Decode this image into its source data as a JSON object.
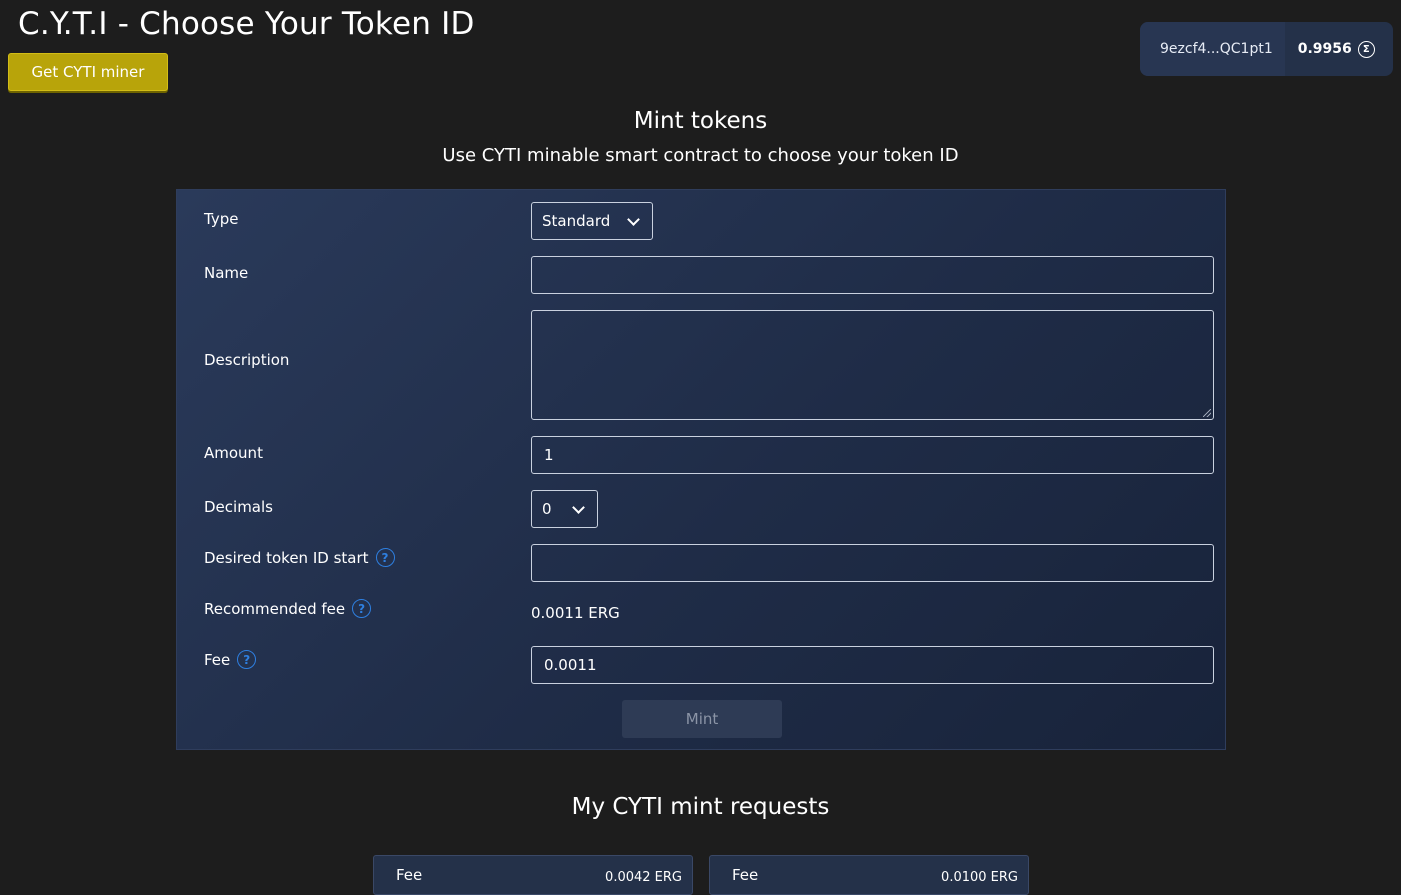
{
  "header": {
    "title": "C.Y.T.I - Choose Your Token ID",
    "get_miner_label": "Get CYTI miner"
  },
  "wallet": {
    "address": "9ezcf4...QC1pt1",
    "balance": "0.9956",
    "currency_icon": "erg-sigma-icon"
  },
  "mint_section": {
    "title": "Mint tokens",
    "subtitle": "Use CYTI minable smart contract to choose your token ID"
  },
  "form": {
    "type_label": "Type",
    "type_value": "Standard",
    "name_label": "Name",
    "name_value": "",
    "description_label": "Description",
    "description_value": "",
    "amount_label": "Amount",
    "amount_value": "1",
    "decimals_label": "Decimals",
    "decimals_value": "0",
    "token_id_start_label": "Desired token ID start",
    "token_id_start_value": "",
    "recommended_fee_label": "Recommended fee",
    "recommended_fee_value": "0.0011 ERG",
    "fee_label": "Fee",
    "fee_value": "0.0011",
    "help_glyph": "?",
    "mint_label": "Mint"
  },
  "requests_section": {
    "title": "My CYTI mint requests",
    "cards": [
      {
        "fee_label": "Fee",
        "fee_value": "0.0042 ERG"
      },
      {
        "fee_label": "Fee",
        "fee_value": "0.0100 ERG"
      }
    ]
  },
  "colors": {
    "background": "#1d1d1d",
    "accent_yellow": "#b8a40a",
    "card_blue": "#243149",
    "help_blue": "#2e7fe0"
  }
}
